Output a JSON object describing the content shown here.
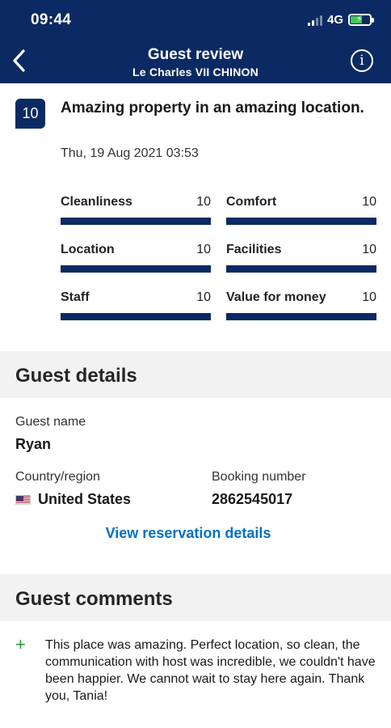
{
  "status_bar": {
    "time": "09:44",
    "network": "4G"
  },
  "header": {
    "title": "Guest review",
    "subtitle": "Le Charles VII CHINON"
  },
  "review": {
    "score": "10",
    "title": "Amazing property in an amazing location.",
    "date": "Thu, 19 Aug 2021 03:53",
    "categories": [
      {
        "label": "Cleanliness",
        "value": "10",
        "fraction": 1.0
      },
      {
        "label": "Comfort",
        "value": "10",
        "fraction": 1.0
      },
      {
        "label": "Location",
        "value": "10",
        "fraction": 1.0
      },
      {
        "label": "Facilities",
        "value": "10",
        "fraction": 1.0
      },
      {
        "label": "Staff",
        "value": "10",
        "fraction": 1.0
      },
      {
        "label": "Value for money",
        "value": "10",
        "fraction": 1.0
      }
    ]
  },
  "guest_details": {
    "heading": "Guest details",
    "name_label": "Guest name",
    "name": "Ryan",
    "country_label": "Country/region",
    "country": "United States",
    "booking_label": "Booking number",
    "booking_number": "2862545017",
    "link_label": "View reservation details"
  },
  "guest_comments": {
    "heading": "Guest comments",
    "positive": "This place was amazing. Perfect location, so clean, the communication with host was incredible, we couldn't have been happier. We cannot wait to stay here again. Thank you, Tania!"
  },
  "colors": {
    "brand": "#0b2a63",
    "link": "#0071c2",
    "positive": "#2e9b3a"
  }
}
